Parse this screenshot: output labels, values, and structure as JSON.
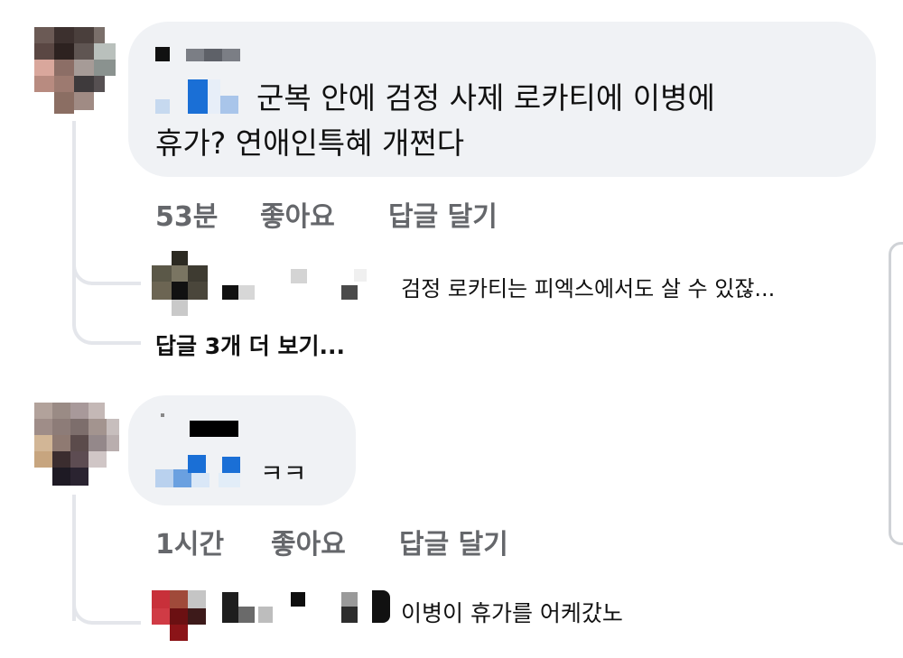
{
  "comments": [
    {
      "text_line1": "군복 안에 검정 사제 로카티에 이병에",
      "text_line2": "휴가? 연애인특혜 개쩐다",
      "time": "53분",
      "like_label": "좋아요",
      "reply_label": "답글 달기",
      "replies": [
        {
          "text": "검정 로카티는 피엑스에서도 살 수 있잖..."
        }
      ],
      "more_replies_label": "답글 3개 더 보기..."
    },
    {
      "text": "ㅋㅋ",
      "time": "1시간",
      "like_label": "좋아요",
      "reply_label": "답글 달기",
      "replies": [
        {
          "text": "이병이 휴가를 어케갔노"
        }
      ]
    }
  ],
  "colors": {
    "bubble": "#f0f2f5",
    "action_text": "#65676b",
    "thread_line": "#e4e6eb",
    "censor_blue": "#1a6fd6"
  }
}
